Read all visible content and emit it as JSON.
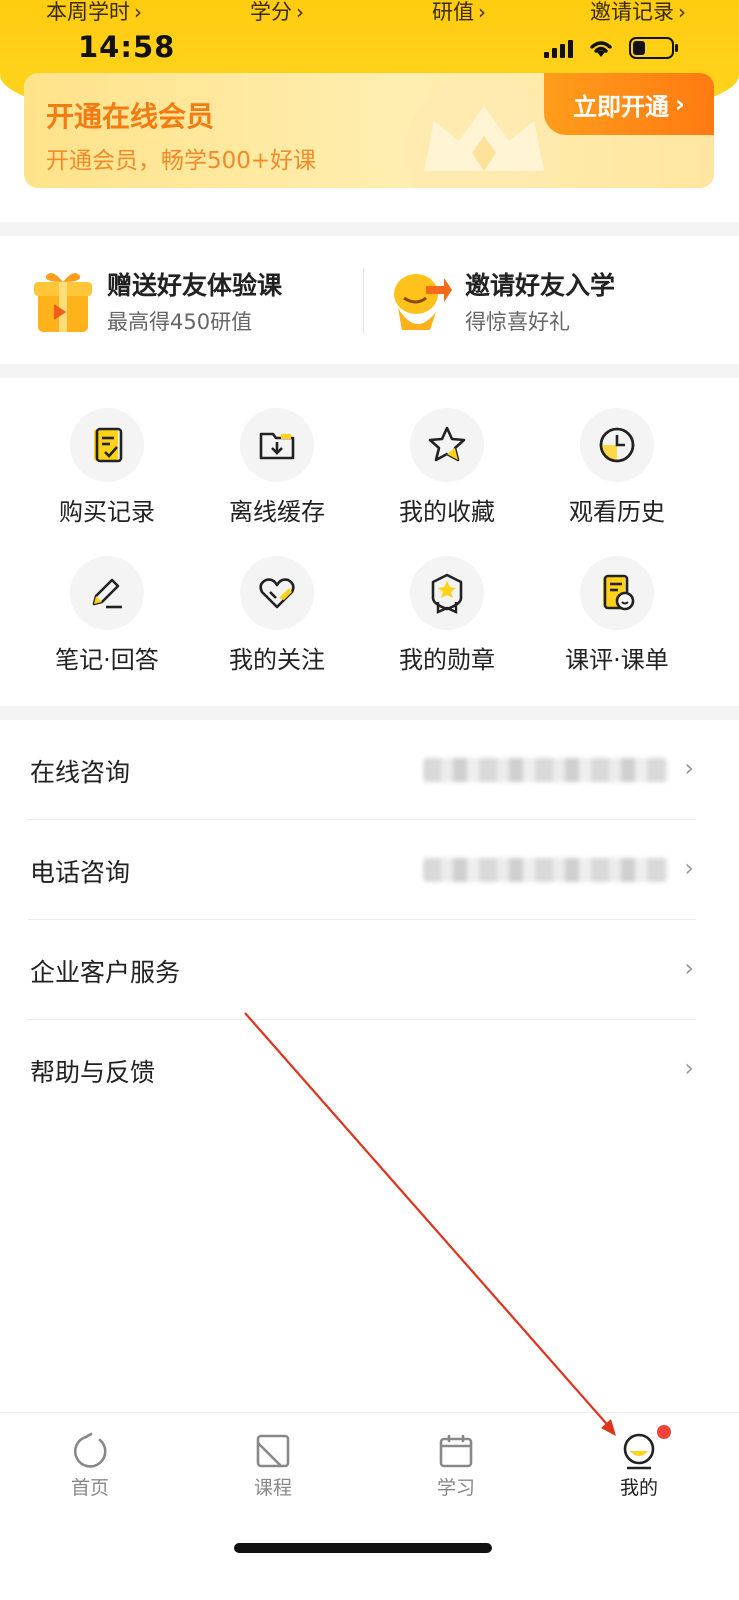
{
  "header": {
    "stats": [
      {
        "label": "本周学时"
      },
      {
        "label": "学分"
      },
      {
        "label": "研值"
      },
      {
        "label": "邀请记录"
      }
    ],
    "status_time": "14:58"
  },
  "vip": {
    "title": "开通在线会员",
    "subtitle": "开通会员，畅学500+好课",
    "button": "立即开通"
  },
  "invite": {
    "items": [
      {
        "title": "赠送好友体验课",
        "subtitle": "最高得450研值",
        "icon": "gift-icon"
      },
      {
        "title": "邀请好友入学",
        "subtitle": "得惊喜好礼",
        "icon": "mascot-invite-icon"
      }
    ]
  },
  "grid": {
    "items": [
      {
        "label": "购买记录",
        "icon": "purchase-record-icon"
      },
      {
        "label": "离线缓存",
        "icon": "offline-cache-icon"
      },
      {
        "label": "我的收藏",
        "icon": "star-icon"
      },
      {
        "label": "观看历史",
        "icon": "clock-icon"
      },
      {
        "label": "笔记·回答",
        "icon": "pencil-icon"
      },
      {
        "label": "我的关注",
        "icon": "heart-icon"
      },
      {
        "label": "我的勋章",
        "icon": "medal-icon"
      },
      {
        "label": "课评·课单",
        "icon": "review-icon"
      }
    ]
  },
  "list": {
    "items": [
      {
        "label": "在线咨询"
      },
      {
        "label": "电话咨询"
      },
      {
        "label": "企业客户服务"
      },
      {
        "label": "帮助与反馈"
      }
    ]
  },
  "tabbar": {
    "tabs": [
      {
        "label": "首页",
        "icon": "home-icon"
      },
      {
        "label": "课程",
        "icon": "course-icon"
      },
      {
        "label": "学习",
        "icon": "calendar-icon"
      },
      {
        "label": "我的",
        "icon": "profile-icon"
      }
    ]
  },
  "colors": {
    "brand_yellow": "#ffcc10",
    "vip_orange": "#f47a12",
    "badge_red": "#f2423a"
  }
}
